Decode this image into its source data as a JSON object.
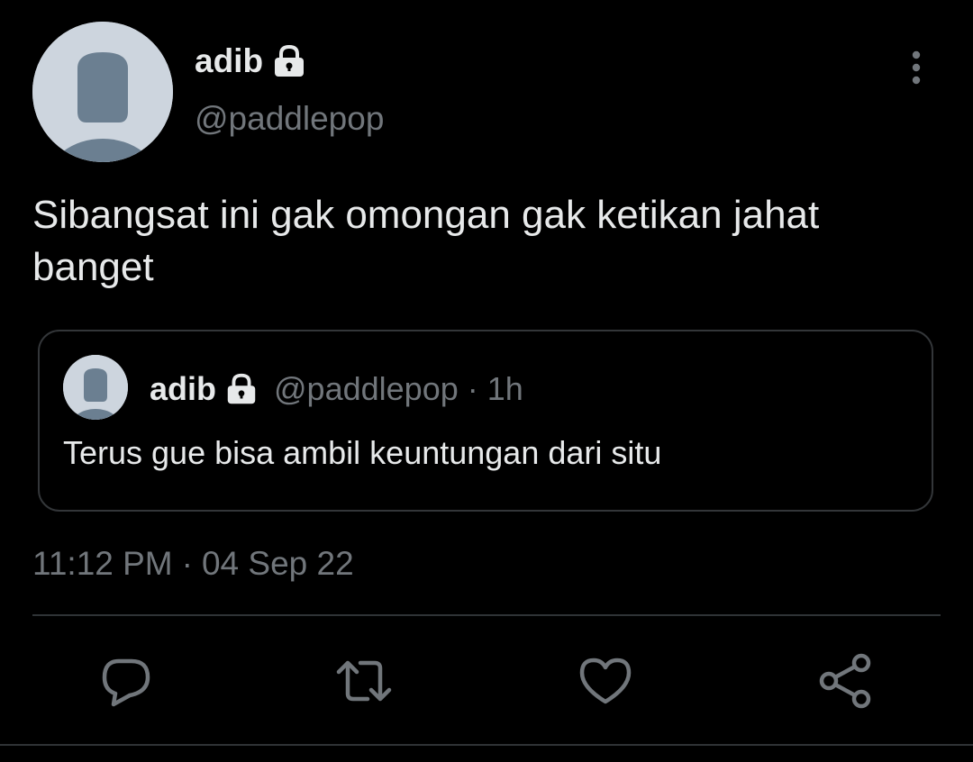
{
  "author": {
    "display_name": "adib",
    "handle": "@paddlepop",
    "protected_icon": "lock-icon",
    "avatar_icon": "default-avatar-icon"
  },
  "tweet": {
    "text": "Sibangsat ini gak omongan gak ketikan jahat banget",
    "timestamp_time": "11:12 PM",
    "timestamp_separator": "·",
    "timestamp_date": "04 Sep 22"
  },
  "quoted_tweet": {
    "display_name": "adib",
    "handle": "@paddlepop",
    "separator": "·",
    "relative_time": "1h",
    "text": "Terus gue bisa ambil keuntungan dari situ"
  },
  "menu": {
    "icon": "more-vertical-icon"
  },
  "actions": [
    {
      "icon": "reply-icon"
    },
    {
      "icon": "retweet-icon"
    },
    {
      "icon": "like-icon"
    },
    {
      "icon": "share-icon"
    }
  ],
  "colors": {
    "background": "#000000",
    "primary_text": "#e7e9ea",
    "secondary_text": "#71767b",
    "border": "#333639",
    "avatar_bg": "#cdd5de",
    "avatar_fg": "#6b7f91"
  }
}
